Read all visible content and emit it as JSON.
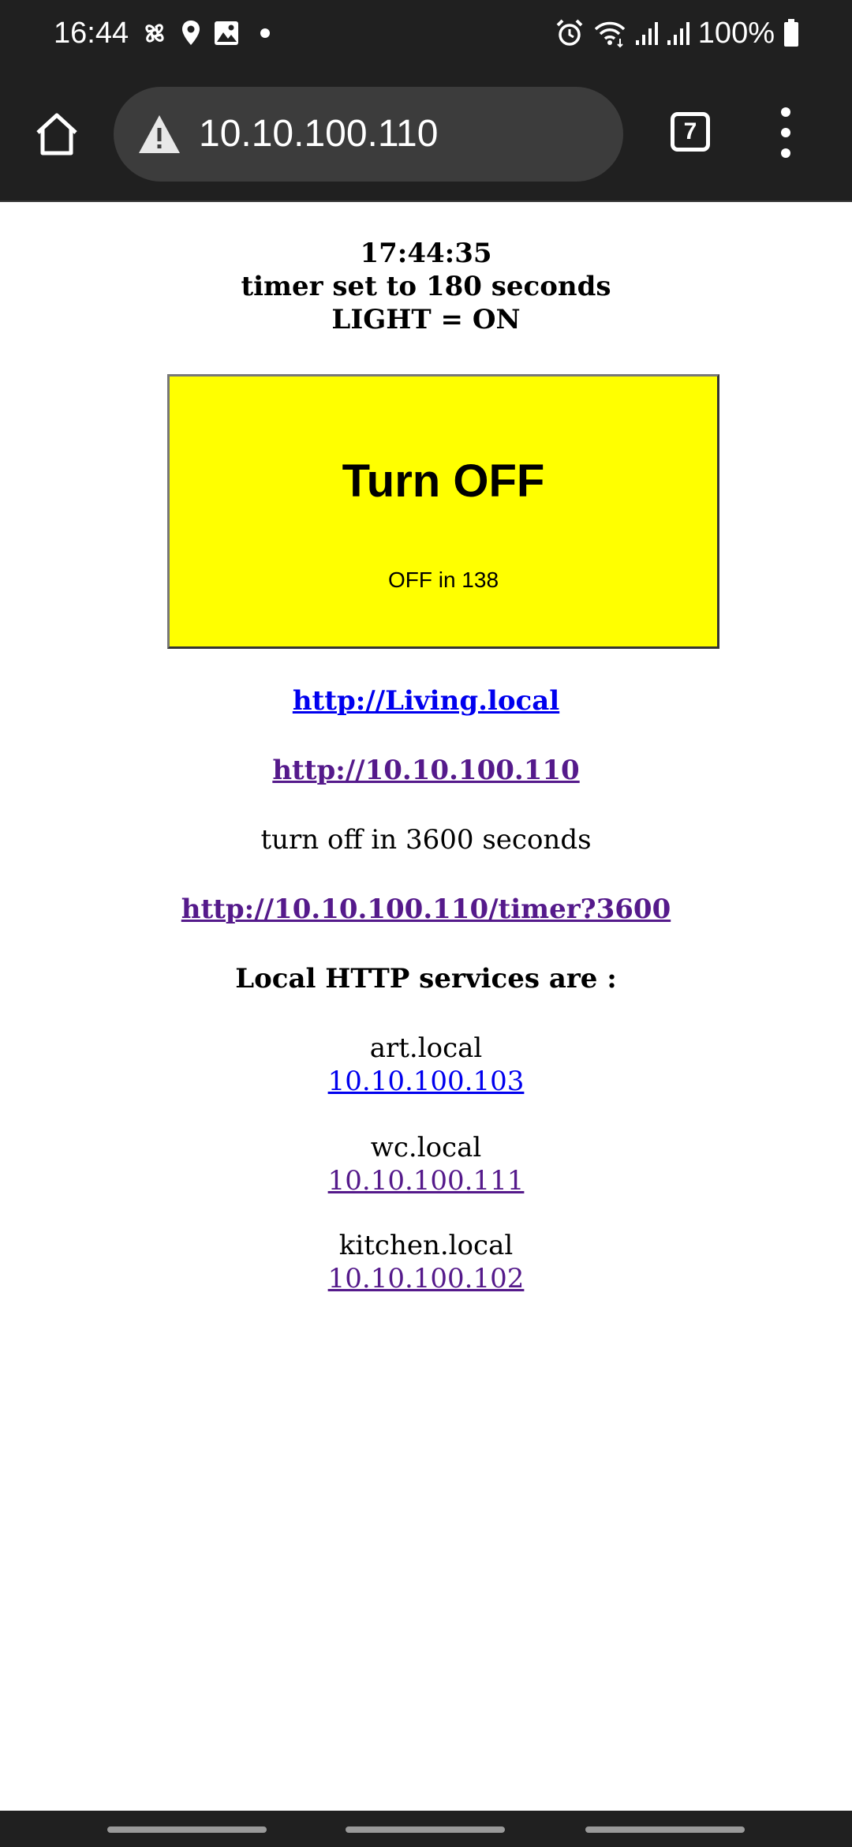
{
  "status_bar": {
    "time": "16:44",
    "battery": "100%",
    "left_icons": [
      "fan-icon",
      "location-icon",
      "gallery-icon",
      "dot-icon"
    ],
    "right_icons": [
      "alarm-icon",
      "wifi-icon",
      "signal-icon",
      "signal-icon",
      "battery-icon"
    ]
  },
  "browser": {
    "url": "10.10.100.110",
    "tab_count": "7",
    "security_icon": "warning-icon"
  },
  "page": {
    "time": "17:44:35",
    "timer_text": "timer set to 180 seconds",
    "light_state": "LIGHT = ON",
    "toggle_button": {
      "label": "Turn OFF",
      "countdown": "OFF in 138",
      "color": "#ffff00"
    },
    "host_link": "http://Living.local",
    "ip_link": "http://10.10.100.110",
    "timer_note": "turn off in 3600 seconds",
    "timer_link": "http://10.10.100.110/timer?3600",
    "services_heading": "Local HTTP services are :",
    "services": [
      {
        "name": "art.local",
        "address": "10.10.100.103"
      },
      {
        "name": "wc.local",
        "address": "10.10.100.111"
      },
      {
        "name": "kitchen.local",
        "address": "10.10.100.102"
      }
    ]
  },
  "colors": {
    "link": "#0000ee",
    "visited_link": "#551a8b",
    "bar_background": "#202020"
  }
}
